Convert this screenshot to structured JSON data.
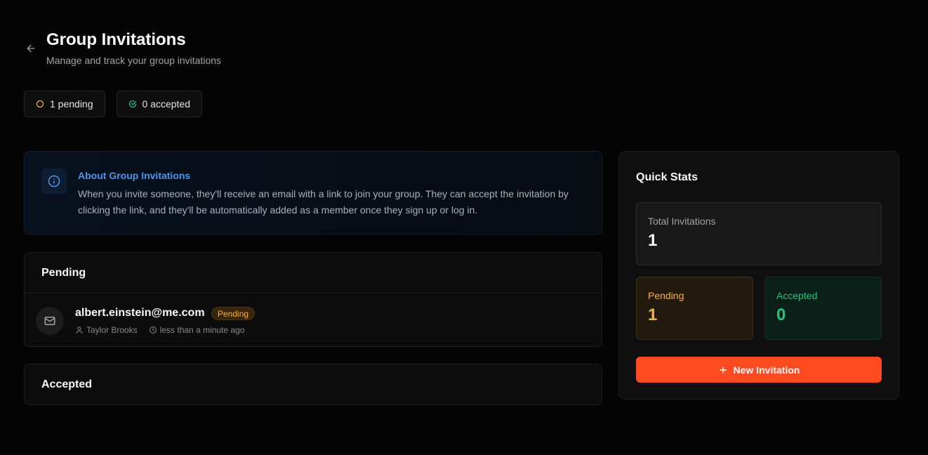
{
  "header": {
    "title": "Group Invitations",
    "subtitle": "Manage and track your group invitations"
  },
  "chips": {
    "pending": "1 pending",
    "accepted": "0 accepted"
  },
  "info": {
    "title": "About Group Invitations",
    "text": "When you invite someone, they'll receive an email with a link to join your group. They can accept the invitation by clicking the link, and they'll be automatically added as a member once they sign up or log in."
  },
  "pending_section": {
    "title": "Pending",
    "invitations": [
      {
        "email": "albert.einstein@me.com",
        "status": "Pending",
        "inviter": "Taylor Brooks",
        "time": "less than a minute ago"
      }
    ]
  },
  "accepted_section": {
    "title": "Accepted"
  },
  "stats": {
    "title": "Quick Stats",
    "total_label": "Total Invitations",
    "total_value": "1",
    "pending_label": "Pending",
    "pending_value": "1",
    "accepted_label": "Accepted",
    "accepted_value": "0",
    "button_label": "New Invitation"
  },
  "colors": {
    "accent": "#ff4b1f",
    "pending": "#f5b342",
    "accepted": "#22c57f",
    "info": "#4f94e6"
  },
  "icons": [
    "arrow-left-icon",
    "circle-icon",
    "check-circle-icon",
    "info-icon",
    "mail-icon",
    "user-icon",
    "clock-icon",
    "plus-icon"
  ]
}
